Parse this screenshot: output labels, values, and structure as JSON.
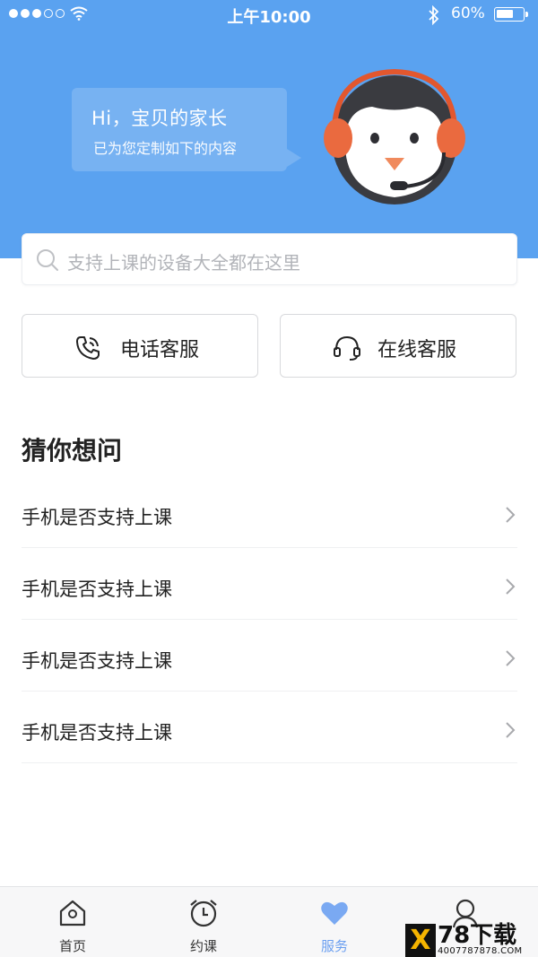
{
  "status_bar": {
    "time": "上午10:00",
    "battery_percent": "60%",
    "battery_level": 0.6,
    "signal_bars": 3
  },
  "greeting": {
    "title": "Hi，宝贝的家长",
    "subtitle": "已为您定制如下的内容"
  },
  "search": {
    "placeholder": "支持上课的设备大全都在这里"
  },
  "service_buttons": {
    "phone": "电话客服",
    "online": "在线客服"
  },
  "faq": {
    "title": "猜你想问",
    "items": [
      {
        "question": "手机是否支持上课"
      },
      {
        "question": "手机是否支持上课"
      },
      {
        "question": "手机是否支持上课"
      },
      {
        "question": "手机是否支持上课"
      }
    ]
  },
  "tabbar": {
    "tabs": [
      {
        "label": "首页",
        "icon": "home-icon"
      },
      {
        "label": "约课",
        "icon": "alarm-clock-icon"
      },
      {
        "label": "服务",
        "icon": "heart-icon",
        "active": true
      },
      {
        "label": "",
        "icon": "user-icon"
      }
    ]
  },
  "watermark": {
    "brand": "78下载",
    "url": "4007787878.COM",
    "mark": "X"
  },
  "colors": {
    "hero": "#5aa2f0",
    "accent": "#6b9ff0"
  }
}
